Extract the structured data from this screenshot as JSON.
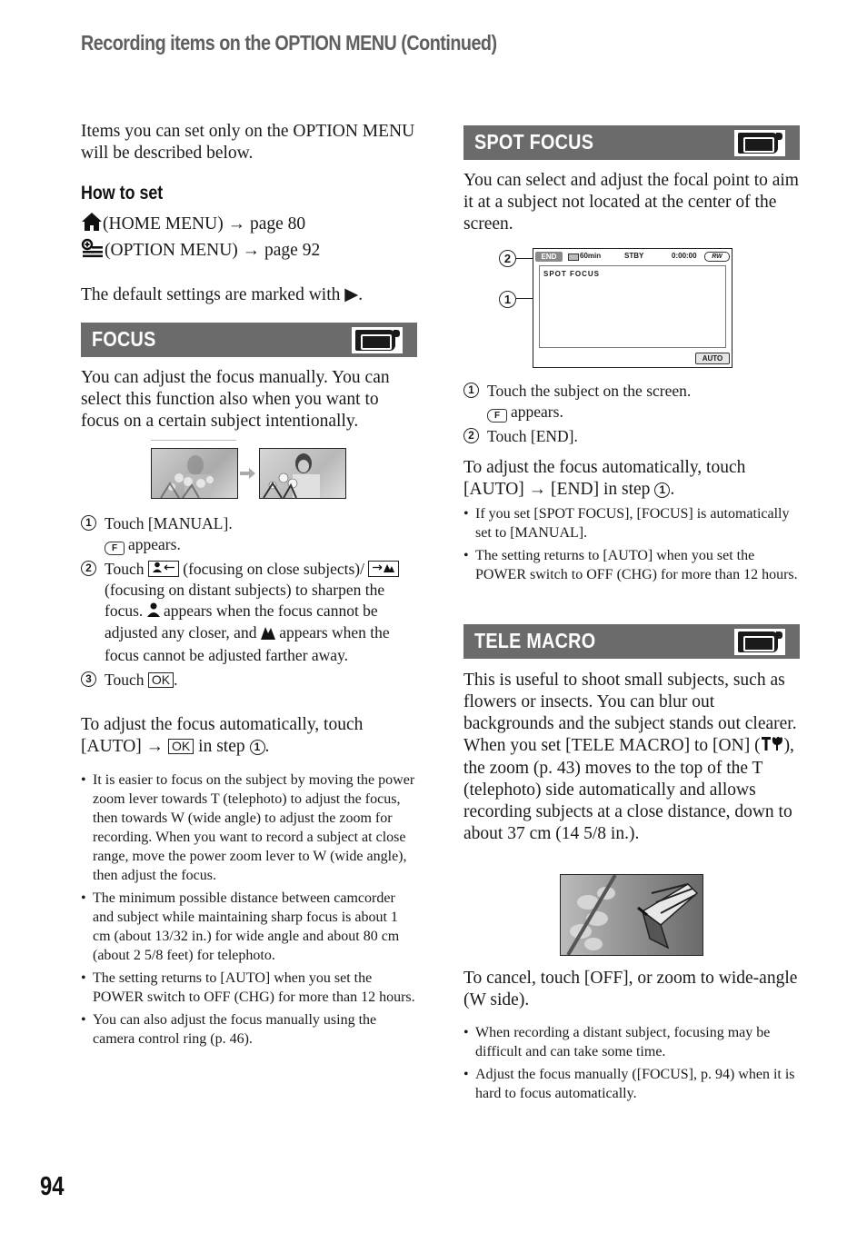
{
  "header": {
    "title": "Recording items on the OPTION MENU (Continued)"
  },
  "intro": "Items you can set only on the OPTION MENU will be described below.",
  "how_to_set": {
    "heading": "How to set",
    "home_line": "(HOME MENU) → page 80",
    "option_line": "(OPTION MENU) → page 92",
    "default_note": "The default settings are marked with ▶."
  },
  "focus": {
    "title": "FOCUS",
    "icon": "camcorder-movie-mode-icon",
    "description": "You can adjust the focus manually. You can select this function also when you want to focus on a certain subject intentionally.",
    "images": [
      "blurred-portrait-with-flowers",
      "sharp-portrait-with-flowers"
    ],
    "step1": "Touch [MANUAL].",
    "step1_sub": "appears.",
    "step2_touch": "Touch",
    "step2_a": "(focusing on close subjects)/",
    "step2_b": "(focusing on distant subjects) to sharpen the focus.",
    "step2_c": "appears when the focus cannot be adjusted any closer, and",
    "step2_d": "appears when the focus cannot be adjusted farther away.",
    "step3_touch": "Touch",
    "ok_label": "OK",
    "auto_line1": "To adjust the focus automatically, touch",
    "auto_line2_a": "[AUTO] →",
    "auto_line2_b": "in step",
    "notes": [
      "It is easier to focus on the subject by moving the power zoom lever towards T (telephoto) to adjust the focus, then towards W (wide angle) to adjust the zoom for recording. When you want to record a subject at close range, move the power zoom lever to W (wide angle), then adjust the focus.",
      "The minimum possible distance between camcorder and subject while maintaining sharp focus is about 1 cm (about 13/32 in.) for wide angle and about 80 cm (about 2 5/8 feet) for telephoto.",
      "The setting returns to [AUTO] when you set the POWER switch to OFF (CHG) for more than 12 hours.",
      "You can also adjust the focus manually using the camera control ring (p. 46)."
    ]
  },
  "spot_focus": {
    "title": "SPOT FOCUS",
    "description": "You can select and adjust the focal point to aim it at a subject not located at the center of the screen.",
    "lcd": {
      "end_button": "END",
      "battery": "60min",
      "status": "STBY",
      "timecode": "0:00:00",
      "media": "RW",
      "screen_label": "SPOT FOCUS",
      "auto_button": "AUTO",
      "callout_1": "1",
      "callout_2": "2"
    },
    "step1": "Touch the subject on the screen.",
    "step1_sub": "appears.",
    "step2": "Touch [END].",
    "auto_line1": "To adjust the focus automatically, touch",
    "auto_line2": "[AUTO] → [END] in step",
    "notes": [
      "If you set [SPOT FOCUS], [FOCUS] is automatically set to [MANUAL].",
      "The setting returns to [AUTO] when you set the POWER switch to OFF (CHG) for more than 12 hours."
    ]
  },
  "tele_macro": {
    "title": "TELE MACRO",
    "description": "This is useful to shoot small subjects, such as flowers or insects. You can blur out backgrounds and the subject stands out clearer.",
    "description2_a": "When you set [TELE MACRO] to [ON] (",
    "description2_b": "), the zoom (p. 43) moves to the top of the T (telephoto) side automatically and allows recording subjects at a close distance, down to about 37 cm (14 5/8 in.).",
    "image": "butterfly-on-flower",
    "cancel": "To cancel, touch [OFF], or zoom to wide-angle (W side).",
    "notes": [
      "When recording a distant subject, focusing may be difficult and can take some time.",
      "Adjust the focus manually ([FOCUS], p. 94) when it is hard to focus automatically."
    ]
  },
  "page_number": "94"
}
